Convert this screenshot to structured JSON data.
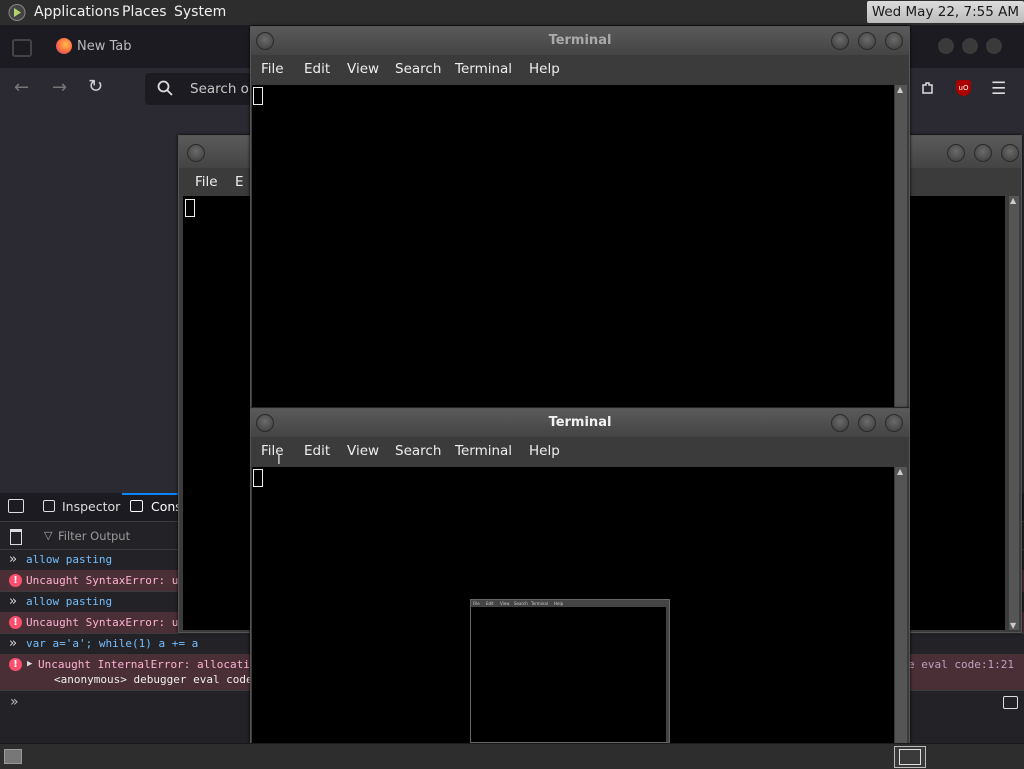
{
  "top_panel": {
    "menus": [
      "Applications",
      "Places",
      "System"
    ],
    "clock": "Wed May 22,  7:55 AM"
  },
  "firefox": {
    "tab_title": "New Tab",
    "url_placeholder": "Search o"
  },
  "devtools": {
    "tabs": {
      "inspector": "Inspector",
      "console": "Cons"
    },
    "filter_placeholder": "Filter Output",
    "rows": [
      {
        "text": "allow pasting"
      },
      {
        "text": "Uncaught SyntaxError: u"
      },
      {
        "text": "allow pasting"
      },
      {
        "text": "Uncaught SyntaxError: u"
      },
      {
        "text": "var a='a'; while(1) a += a"
      },
      {
        "text": "Uncaught InternalError: allocati",
        "sub": "<anonymous>  debugger eval code"
      }
    ],
    "source_link": "e eval code:1:21"
  },
  "terminal_back": {
    "menu": [
      "File",
      "E"
    ]
  },
  "terminal_top": {
    "title": "Terminal",
    "menu": [
      "File",
      "Edit",
      "View",
      "Search",
      "Terminal",
      "Help"
    ]
  },
  "terminal_front": {
    "title": "Terminal",
    "menu": [
      "File",
      "Edit",
      "View",
      "Search",
      "Terminal",
      "Help"
    ]
  },
  "mini_terminal": {
    "menu": [
      "File",
      "Edit",
      "View",
      "Search",
      "Terminal",
      "Help"
    ]
  },
  "colors": {
    "terminal_bg": "#000000",
    "window_frame": "#3b3b3b",
    "error_bg": "#4b2f36"
  }
}
